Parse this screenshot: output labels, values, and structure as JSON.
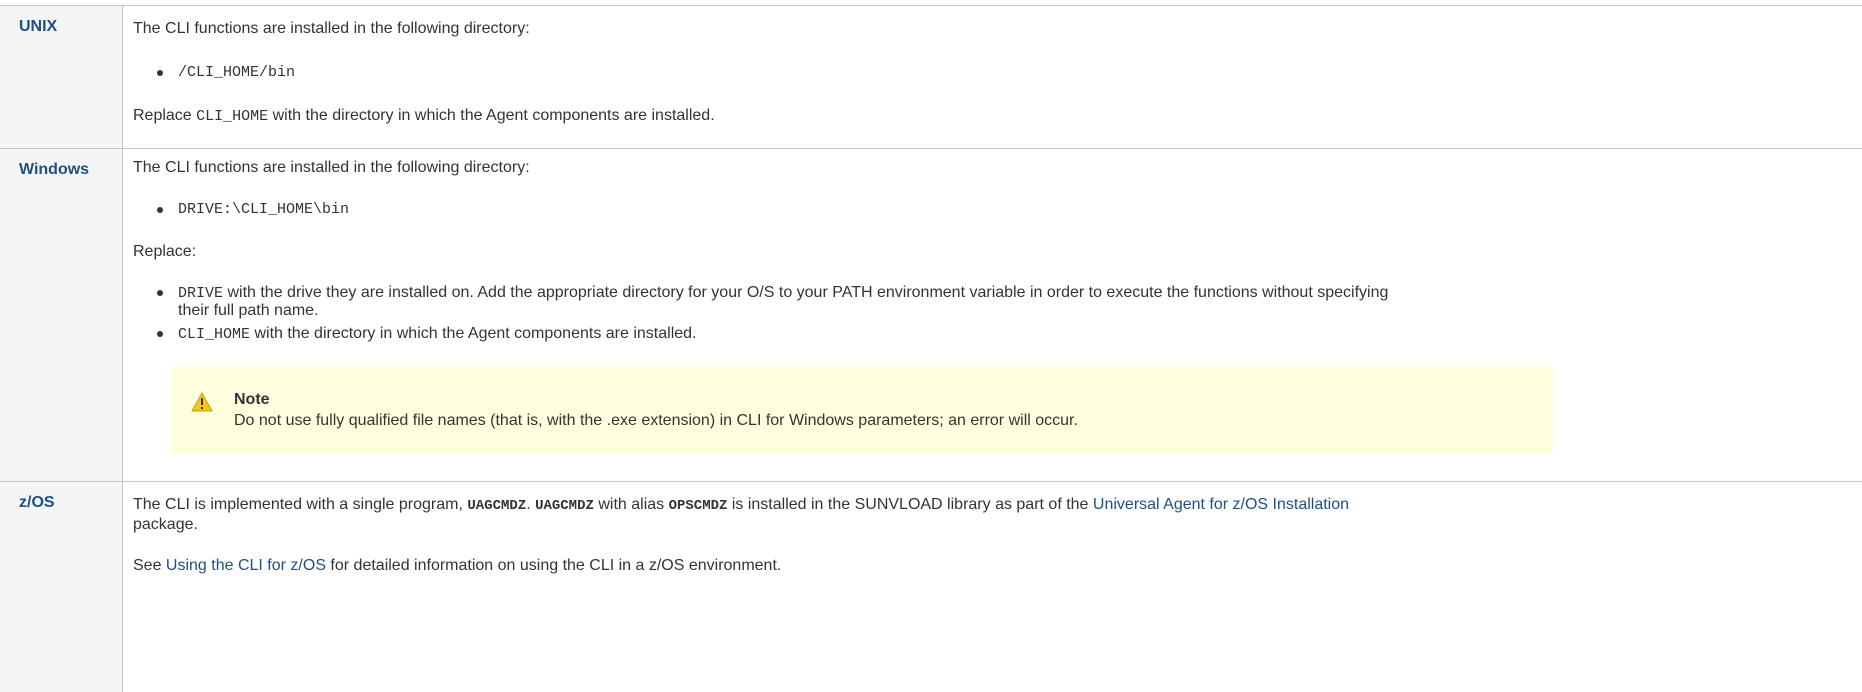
{
  "rows": [
    {
      "header": "UNIX",
      "intro": "The CLI functions are installed in the following directory:",
      "path": "/CLI_HOME/bin",
      "replace_prefix": "Replace ",
      "replace_code": "CLI_HOME",
      "replace_suffix": " with the directory in which the Agent components are installed."
    },
    {
      "header": "Windows",
      "intro": "The CLI functions are installed in the following directory:",
      "path": "DRIVE:\\CLI_HOME\\bin",
      "replace_label": "Replace:",
      "items": [
        {
          "code": "DRIVE",
          "text_line1": " with the drive they are installed on. Add the appropriate directory for your O/S to your PATH environment variable in order to execute the functions without specifying",
          "text_line2": "their full path name."
        },
        {
          "code": "CLI_HOME",
          "text_line1": " with the directory in which the Agent components are installed."
        }
      ],
      "note": {
        "icon": "warning-icon",
        "title": "Note",
        "text": "Do not use fully qualified file names (that is, with the .exe extension) in CLI for Windows parameters; an error will occur."
      }
    },
    {
      "header": "z/OS",
      "p1_a": "The CLI is implemented with a single program, ",
      "p1_code1": "UAGCMDZ",
      "p1_b": ". ",
      "p1_code2": "UAGCMDZ",
      "p1_c": " with alias ",
      "p1_code3": "OPSCMDZ",
      "p1_d": " is installed in the SUNVLOAD library as part of the ",
      "p1_link": "Universal Agent for z/OS Installation",
      "p1_line2": "package.",
      "p2_a": "See ",
      "p2_link": "Using the CLI for z/OS",
      "p2_b": " for detailed information on using the CLI in a z/OS environment."
    }
  ],
  "colors": {
    "header_text": "#205081",
    "link": "#205081",
    "note_bg": "#ffffe0",
    "border": "#c1c7d0"
  }
}
